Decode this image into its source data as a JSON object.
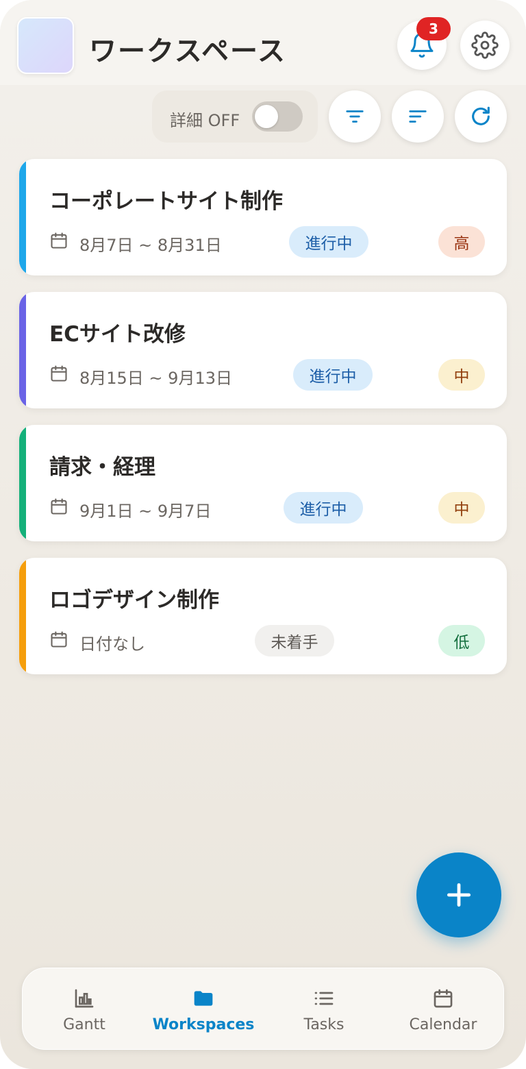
{
  "header": {
    "title": "ワークスペース",
    "notification_count": "3"
  },
  "toolbar": {
    "detail_label": "詳細 OFF",
    "detail_on": false
  },
  "projects": [
    {
      "title": "コーポレートサイト制作",
      "date": "8月7日 ~ 8月31日",
      "status": "進行中",
      "priority": "高",
      "accent": "#1ea7ea"
    },
    {
      "title": "ECサイト改修",
      "date": "8月15日 ~ 9月13日",
      "status": "進行中",
      "priority": "中",
      "accent": "#6a63e6"
    },
    {
      "title": "請求・経理",
      "date": "9月1日 ~ 9月7日",
      "status": "進行中",
      "priority": "中",
      "accent": "#14b07a"
    },
    {
      "title": "ロゴデザイン制作",
      "date": "日付なし",
      "status": "未着手",
      "priority": "低",
      "accent": "#f59e0b"
    }
  ],
  "nav": {
    "items": [
      {
        "label": "Gantt",
        "icon": "chart-icon"
      },
      {
        "label": "Workspaces",
        "icon": "folder-icon",
        "active": true
      },
      {
        "label": "Tasks",
        "icon": "list-icon"
      },
      {
        "label": "Calendar",
        "icon": "calendar-icon"
      }
    ]
  },
  "colors": {
    "accent": "#0a84c8",
    "badge": "#e02424"
  }
}
